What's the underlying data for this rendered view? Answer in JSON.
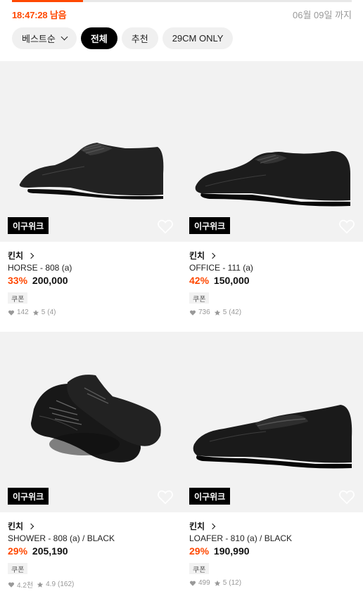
{
  "timer": {
    "remaining": "18:47:28 남음",
    "deadline": "06월 09일 까지",
    "progress": 0.21
  },
  "filters": [
    {
      "label": "베스트순",
      "active": false,
      "dropdown": true
    },
    {
      "label": "전체",
      "active": true
    },
    {
      "label": "추천",
      "active": false
    },
    {
      "label": "29CM ONLY",
      "active": false
    }
  ],
  "products": [
    {
      "badge": "이구위크",
      "brand": "킨치",
      "name": "HORSE - 808 (a)",
      "discount": "33%",
      "price": "200,000",
      "coupon": "쿠폰",
      "likes": "142",
      "rating": "5",
      "reviews": "(4)"
    },
    {
      "badge": "이구위크",
      "brand": "킨치",
      "name": "OFFICE - 111 (a)",
      "discount": "42%",
      "price": "150,000",
      "coupon": "쿠폰",
      "likes": "736",
      "rating": "5",
      "reviews": "(42)"
    },
    {
      "badge": "이구위크",
      "brand": "킨치",
      "name": "SHOWER - 808 (a) / BLACK",
      "discount": "29%",
      "price": "205,190",
      "coupon": "쿠폰",
      "likes": "4.2천",
      "rating": "4.9",
      "reviews": "(162)"
    },
    {
      "badge": "이구위크",
      "brand": "킨치",
      "name": "LOAFER - 810 (a) / BLACK",
      "discount": "29%",
      "price": "190,990",
      "coupon": "쿠폰",
      "likes": "499",
      "rating": "5",
      "reviews": "(12)"
    }
  ],
  "colors": {
    "accent": "#ff4800",
    "chip_active": "#000000",
    "image_bg": "#f2f2f2"
  }
}
